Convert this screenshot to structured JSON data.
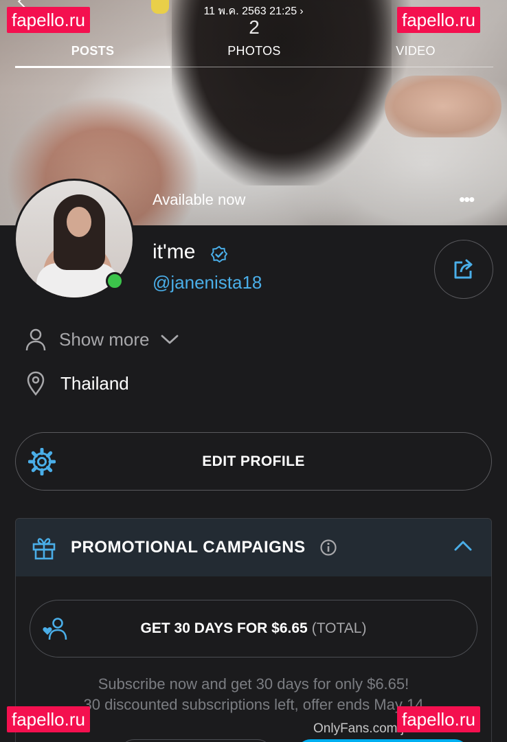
{
  "status_bar": {
    "time": "11 พ.ค. 2563 21:25",
    "chevron": "›"
  },
  "tabs": [
    {
      "count": "",
      "label": "POSTS",
      "active": true
    },
    {
      "count": "2",
      "label": "PHOTOS",
      "active": false
    },
    {
      "count": "",
      "label": "VIDEO",
      "active": false
    }
  ],
  "cover": {
    "availability": "Available now",
    "more_icon": "•••"
  },
  "profile": {
    "name": "it'me",
    "handle": "@janenista18",
    "show_more": "Show more",
    "location": "Thailand"
  },
  "edit_profile_label": "EDIT PROFILE",
  "promo": {
    "title": "PROMOTIONAL CAMPAIGNS",
    "offer_label": "GET 30 DAYS FOR $6.65",
    "offer_suffix": "(TOTAL)",
    "desc_line1": "Subscribe now and get 30 days for only $6.65!",
    "desc_line2": "30 discounted subscriptions left, offer ends May 14"
  },
  "watermark": "fapello.ru",
  "site_url": "OnlyFans.com/janenista18",
  "colors": {
    "background": "#1b1b1d",
    "accent_blue": "#4aaee8",
    "online_green": "#3cc44b",
    "promo_header": "#232b33",
    "watermark_red": "#f4104f"
  },
  "icons": {
    "back": "chevron-left-icon",
    "more": "more-dots-icon",
    "verified": "verified-check-icon",
    "share": "share-icon",
    "user": "user-icon",
    "chevron_down": "chevron-down-icon",
    "location": "location-pin-icon",
    "gear": "gear-icon",
    "gift": "gift-icon",
    "info": "info-icon",
    "chevron_up": "chevron-up-icon",
    "subscriber": "subscriber-heart-icon"
  }
}
